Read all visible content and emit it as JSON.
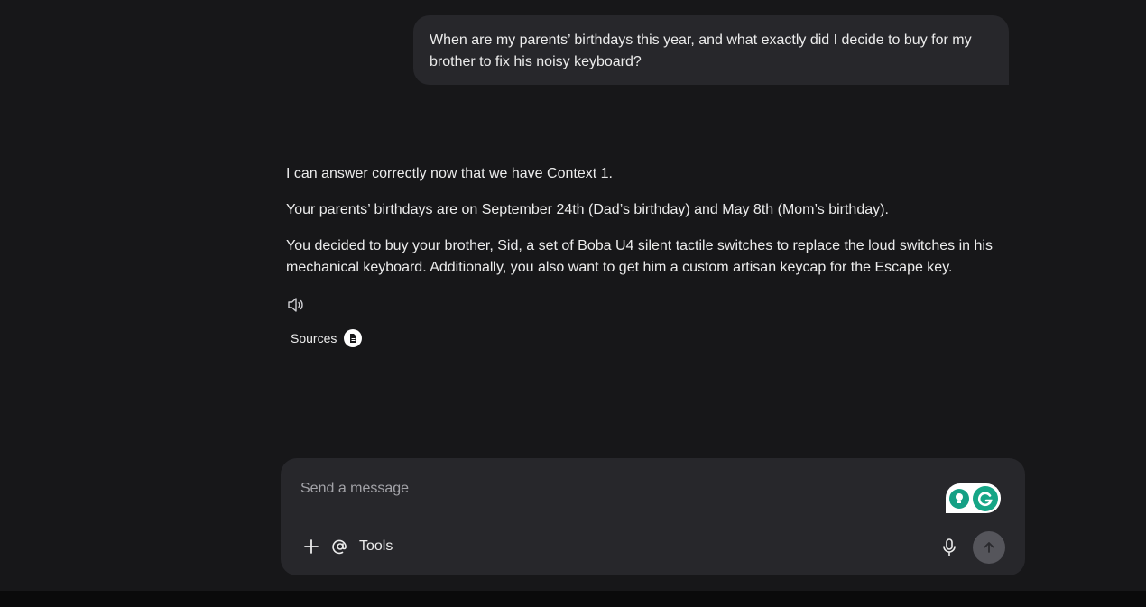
{
  "conversation": {
    "user_message": "When are my parents’ birthdays this year, and what exactly did I decide to buy for my brother to fix his noisy keyboard?",
    "assistant_paragraphs": [
      "I can answer correctly now that we have Context 1.",
      "Your parents’ birthdays are on September 24th (Dad’s birthday) and May 8th (Mom’s birthday).",
      "You decided to buy your brother, Sid, a set of Boba U4 silent tactile switches to replace the loud switches in his mechanical keyboard. Additionally, you also want to get him a custom artisan keycap for the Escape key."
    ],
    "actions": {
      "speaker_icon": "speaker-icon",
      "sources_label": "Sources",
      "sources_icon": "document-icon"
    }
  },
  "composer": {
    "placeholder": "Send a message",
    "tools_label": "Tools",
    "icons": {
      "add": "plus-icon",
      "mention": "at-icon",
      "mic": "microphone-icon",
      "send": "arrow-up-icon",
      "grammarly": "grammarly-icon"
    }
  },
  "colors": {
    "background": "#171719",
    "bubble": "#27272b",
    "text": "#ececec",
    "placeholder": "#a3a3a8",
    "send_button": "#55555b",
    "grammarly_green": "#15a686"
  }
}
